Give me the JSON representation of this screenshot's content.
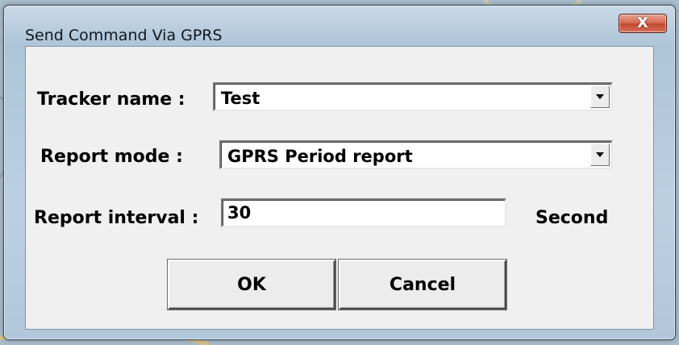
{
  "window": {
    "title": "Send Command Via GPRS",
    "close_glyph": "X"
  },
  "form": {
    "tracker_name_label": "Tracker name :",
    "tracker_name_value": "Test",
    "report_mode_label": "Report mode :",
    "report_mode_value": "GPRS Period report",
    "report_interval_label": "Report interval :",
    "report_interval_value": "30",
    "report_interval_unit": "Second"
  },
  "buttons": {
    "ok_label": "OK",
    "cancel_label": "Cancel"
  },
  "icons": {
    "close": "close-icon",
    "dropdown": "chevron-down-icon"
  },
  "colors": {
    "close_button": "#c94a32",
    "dialog_background": "#f0f0f0",
    "window_frame": "#b5cadf"
  }
}
